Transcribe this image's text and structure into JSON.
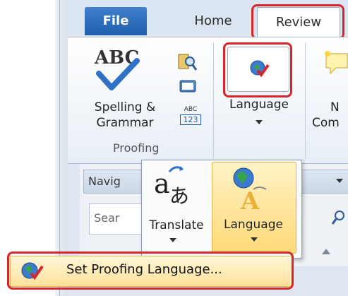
{
  "tabs": {
    "file": "File",
    "home": "Home",
    "review": "Review"
  },
  "proofing": {
    "spelling_label": "Spelling &",
    "grammar_label": "Grammar",
    "group_label": "Proofing",
    "abc_text": "ABC",
    "abc_small": "ABC",
    "abc_nums": "123"
  },
  "language_btn": {
    "label": "Language"
  },
  "new_comment": {
    "label_top": "N",
    "label_bottom": "Com"
  },
  "nav_pane": {
    "header_text": "Navig",
    "search_placeholder": "Sear"
  },
  "dropdown": {
    "translate_label": "Translate",
    "language_label": "Language",
    "translate_glyph_a": "a",
    "translate_glyph_jp": "あ"
  },
  "menu": {
    "set_proofing_language": "Set Proofing Language..."
  },
  "colors": {
    "highlight_red": "#d7262a",
    "file_tab_blue": "#2b6fc0",
    "hover_gold": "#ffe29b"
  }
}
